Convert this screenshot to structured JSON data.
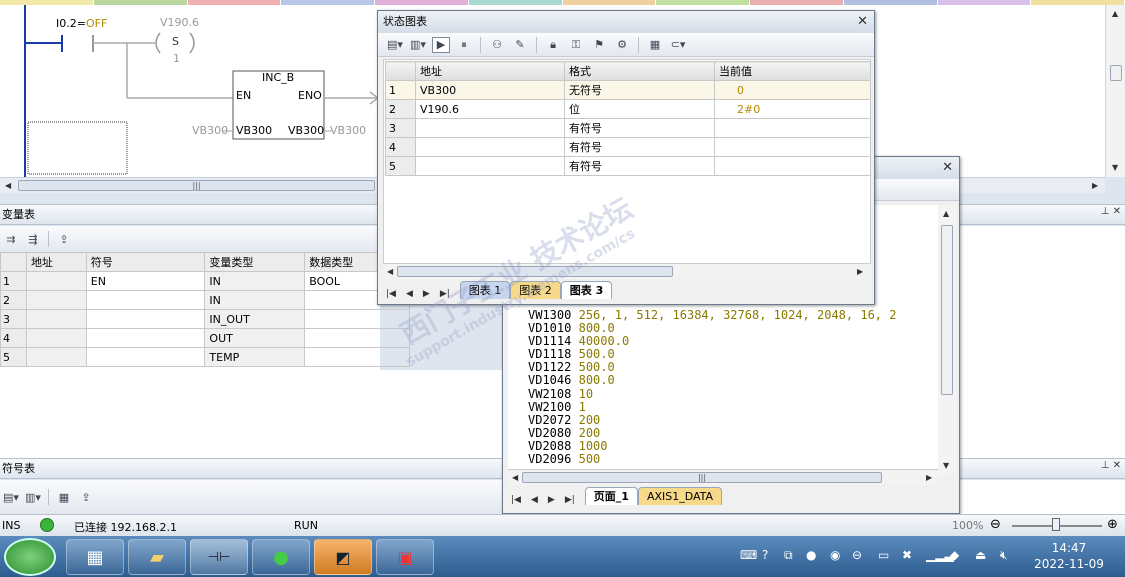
{
  "colors": {
    "top_strip": [
      "#f2e8a8",
      "#b8d8a0",
      "#f0b0b0",
      "#b8c8e8",
      "#e0b0d8",
      "#a8d8d0",
      "#f0d0a0",
      "#c0e0a0",
      "#e8b0b0",
      "#b0c0e0",
      "#d8c0e8",
      "#f0e0a0"
    ],
    "accent_olive": "#b58b00",
    "taskbar": "#2d5c8e"
  },
  "ladder": {
    "contact_label": "I0.2=",
    "contact_state": "OFF",
    "coil_address": "V190.6",
    "coil_type": "S",
    "coil_count": "1",
    "box_title": "INC_B",
    "box_en": "EN",
    "box_eno": "ENO",
    "box_in_addr": "VB300",
    "box_out_addr": "VB300",
    "in_value": "VB300",
    "out_value": "VB300"
  },
  "var_table": {
    "title": "变量表",
    "headers": [
      "",
      "地址",
      "符号",
      "变量类型",
      "数据类型"
    ],
    "rows": [
      {
        "n": "1",
        "addr": "",
        "sym": "EN",
        "vtype": "IN",
        "dtype": "BOOL"
      },
      {
        "n": "2",
        "addr": "",
        "sym": "",
        "vtype": "IN",
        "dtype": ""
      },
      {
        "n": "3",
        "addr": "",
        "sym": "",
        "vtype": "IN_OUT",
        "dtype": ""
      },
      {
        "n": "4",
        "addr": "",
        "sym": "",
        "vtype": "OUT",
        "dtype": ""
      },
      {
        "n": "5",
        "addr": "",
        "sym": "",
        "vtype": "TEMP",
        "dtype": ""
      }
    ]
  },
  "symbol_table": {
    "title": "符号表"
  },
  "status_chart": {
    "title": "状态图表",
    "headers": [
      "",
      "地址",
      "格式",
      "当前值"
    ],
    "rows": [
      {
        "n": "1",
        "addr": "VB300",
        "fmt": "无符号",
        "val": "0"
      },
      {
        "n": "2",
        "addr": "V190.6",
        "fmt": "位",
        "val": "2#0"
      },
      {
        "n": "3",
        "addr": "",
        "fmt": "有符号",
        "val": ""
      },
      {
        "n": "4",
        "addr": "",
        "fmt": "有符号",
        "val": ""
      },
      {
        "n": "5",
        "addr": "",
        "fmt": "有符号",
        "val": ""
      }
    ],
    "tabs": [
      "图表 1",
      "图表 2",
      "图表 3"
    ]
  },
  "data_page": {
    "lines": [
      {
        "addr": "VW1300",
        "val": "256, 1, 512, 16384, 32768, 1024, 2048, 16, 2"
      },
      {
        "addr": "VD1010",
        "val": "800.0"
      },
      {
        "addr": "VD1114",
        "val": "40000.0"
      },
      {
        "addr": "VD1118",
        "val": "500.0"
      },
      {
        "addr": "VD1122",
        "val": "500.0"
      },
      {
        "addr": "VD1046",
        "val": "800.0"
      },
      {
        "addr": "VW2108",
        "val": "10"
      },
      {
        "addr": "VW2100",
        "val": "1"
      },
      {
        "addr": "VD2072",
        "val": "200"
      },
      {
        "addr": "VD2080",
        "val": "200"
      },
      {
        "addr": "VD2088",
        "val": "1000"
      },
      {
        "addr": "VD2096",
        "val": "500"
      }
    ],
    "tabs": [
      "页面_1",
      "AXIS1_DATA"
    ]
  },
  "status_bar": {
    "mode": "INS",
    "connection": "已连接 192.168.2.1",
    "plc_state": "RUN",
    "zoom": "100%"
  },
  "taskbar": {
    "time": "14:47",
    "date": "2022-11-09",
    "apps": [
      "ie-icon",
      "calculator-icon",
      "explorer-icon",
      "ladder-app-icon",
      "wechat-icon",
      "remote-icon",
      "plc-tool-icon"
    ]
  },
  "watermark": {
    "cn": "西门子工业 技术论坛",
    "en": "support.industry.siemens.com/cs"
  }
}
